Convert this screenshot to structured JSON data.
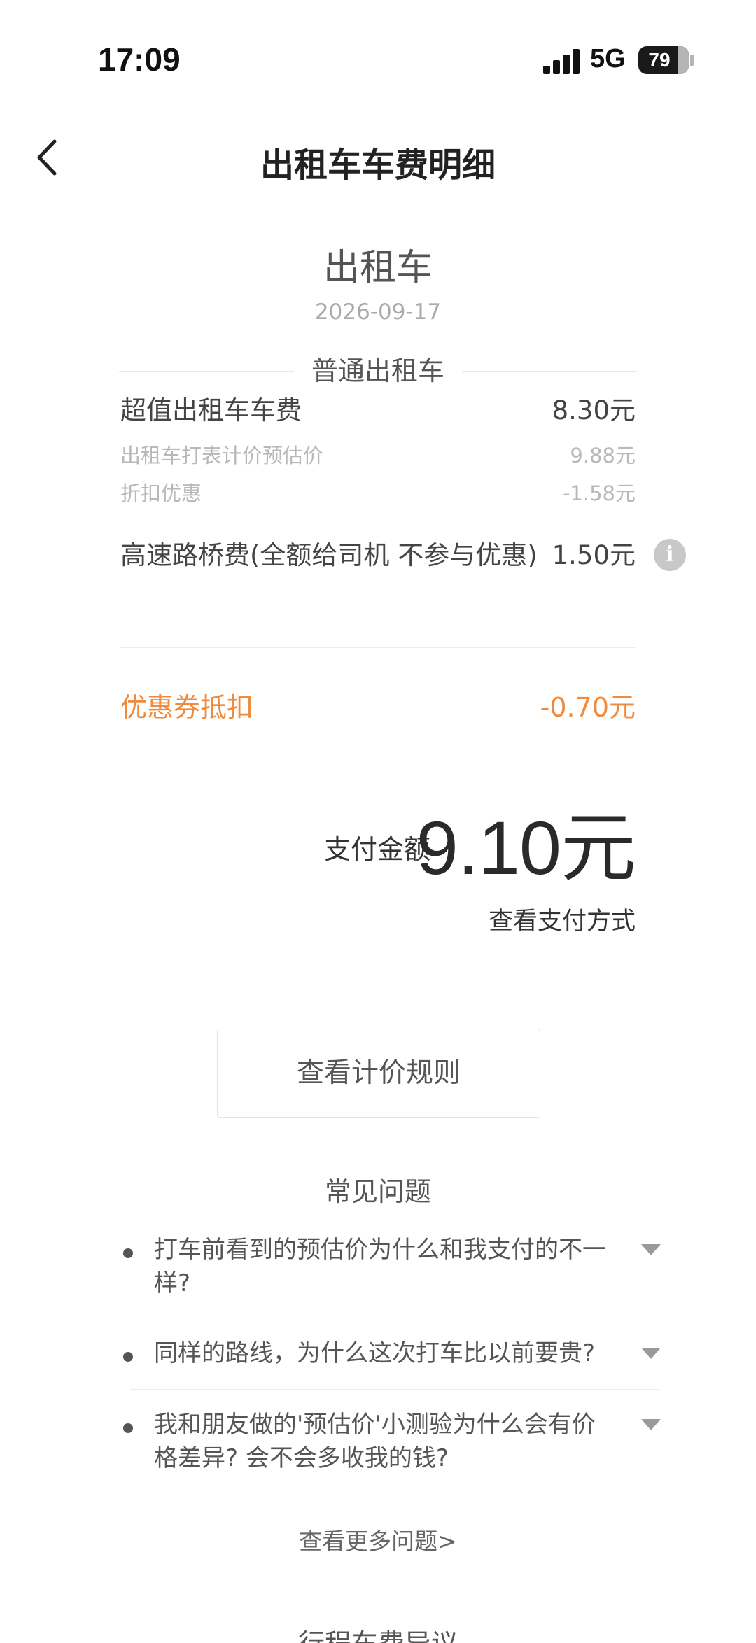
{
  "status_bar": {
    "time": "17:09",
    "network": "5G",
    "battery": "79"
  },
  "nav": {
    "title": "出租车车费明细"
  },
  "ride": {
    "title": "出租车",
    "date": "2026-09-17"
  },
  "section": {
    "title": "普通出租车"
  },
  "fare": {
    "main_label": "超值出租车车费",
    "main_value": "8.30元",
    "meter_label": "出租车打表计价预估价",
    "meter_value": "9.88元",
    "discount_label": "折扣优惠",
    "discount_value": "-1.58元",
    "toll_label": "高速路桥费(全额给司机 不参与优惠)",
    "toll_value": "1.50元",
    "coupon_label": "优惠券抵扣",
    "coupon_value": "-0.70元"
  },
  "payment": {
    "label": "支付金额",
    "amount": "9.10元",
    "method_link": "查看支付方式"
  },
  "rules_button": "查看计价规则",
  "faq": {
    "title": "常见问题",
    "items": [
      {
        "question": "打车前看到的预估价为什么和我支付的不一样?"
      },
      {
        "question": "同样的路线，为什么这次打车比以前要贵?"
      },
      {
        "question": "我和朋友做的'预估价'小测验为什么会有价格差异? 会不会多收我的钱?"
      }
    ],
    "more": "查看更多问题>"
  },
  "next_section": {
    "title": "行程车费异议"
  },
  "colors": {
    "accent": "#f08a3c",
    "text": "#333333",
    "muted": "#b8b8b8"
  }
}
